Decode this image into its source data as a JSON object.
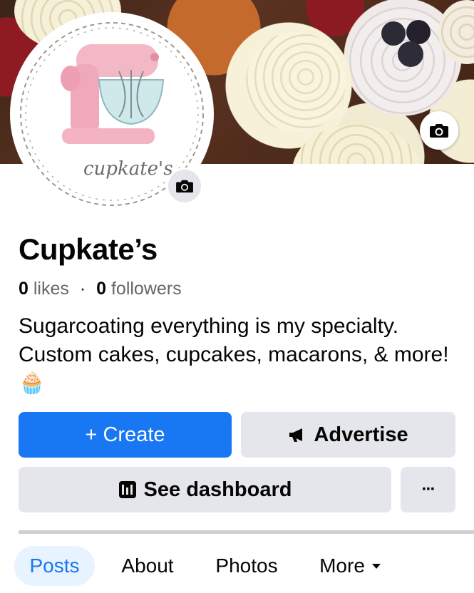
{
  "page": {
    "name": "Cupkate’s",
    "likes_count": "0",
    "likes_label": "likes",
    "separator": "·",
    "followers_count": "0",
    "followers_label": "followers",
    "bio": "Sugarcoating everything is my specialty. Custom cakes, cupcakes, macarons, & more!",
    "bio_emoji": "🧁",
    "logo_script": "cupkate's"
  },
  "actions": {
    "create_label": "+ Create",
    "advertise_label": "Advertise",
    "dashboard_label": "See dashboard",
    "more_label": "···"
  },
  "tabs": [
    {
      "label": "Posts",
      "active": true
    },
    {
      "label": "About",
      "active": false
    },
    {
      "label": "Photos",
      "active": false
    },
    {
      "label": "More",
      "active": false
    }
  ],
  "icons": {
    "cover_camera": "camera-icon",
    "avatar_camera": "camera-icon",
    "advertise": "megaphone-icon",
    "dashboard": "dashboard-icon",
    "more_tab": "caret-down-icon"
  },
  "colors": {
    "primary": "#1877f2",
    "secondary_button": "#e4e6eb",
    "active_tab_bg": "#e7f3ff",
    "muted_text": "#65676b"
  }
}
